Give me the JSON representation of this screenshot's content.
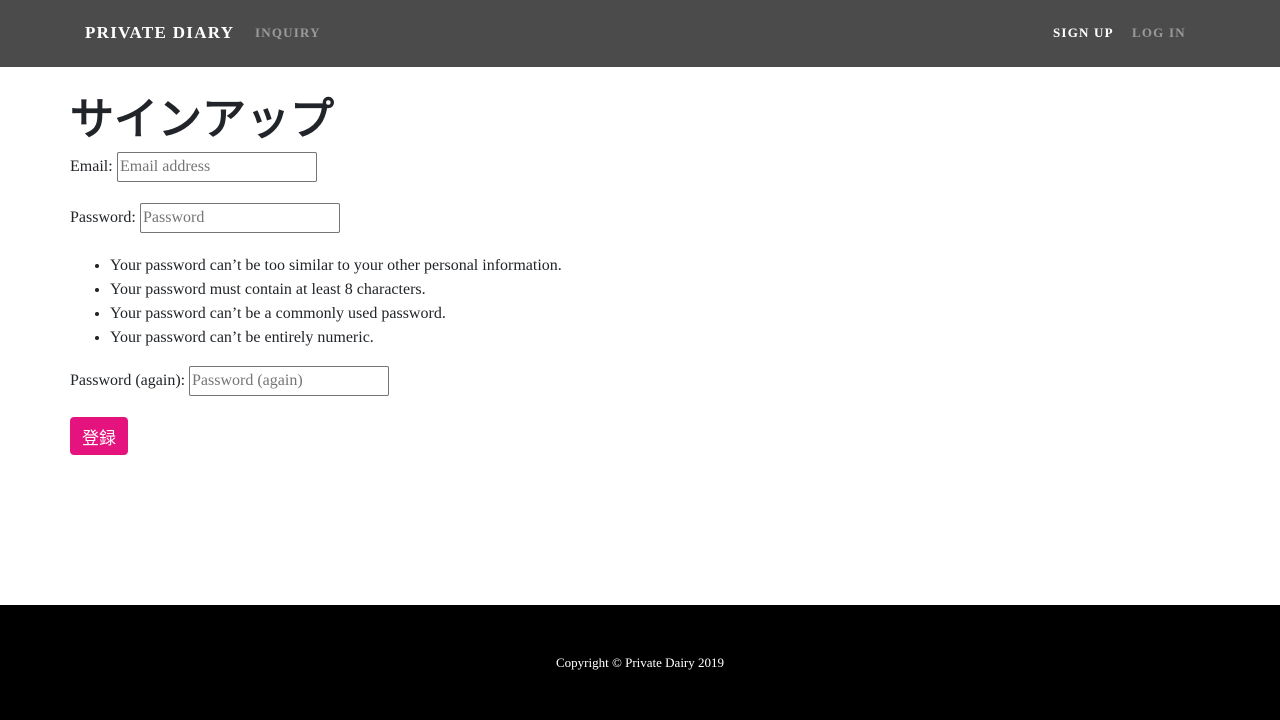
{
  "navbar": {
    "brand": "PRIVATE DIARY",
    "links": {
      "inquiry": "INQUIRY",
      "signup": "SIGN UP",
      "login": "LOG IN"
    }
  },
  "main": {
    "title": "サインアップ",
    "email": {
      "label": "Email:",
      "placeholder": "Email address",
      "value": ""
    },
    "password": {
      "label": "Password:",
      "placeholder": "Password",
      "value": ""
    },
    "help_items": [
      "Your password can’t be too similar to your other personal information.",
      "Your password must contain at least 8 characters.",
      "Your password can’t be a commonly used password.",
      "Your password can’t be entirely numeric."
    ],
    "password_again": {
      "label": "Password (again):",
      "placeholder": "Password (again)",
      "value": ""
    },
    "submit_label": "登録"
  },
  "footer": {
    "copyright": "Copyright © Private Dairy 2019"
  },
  "colors": {
    "navbar_bg": "#4b4b4b",
    "accent": "#e4137d",
    "footer_bg": "#000000"
  }
}
